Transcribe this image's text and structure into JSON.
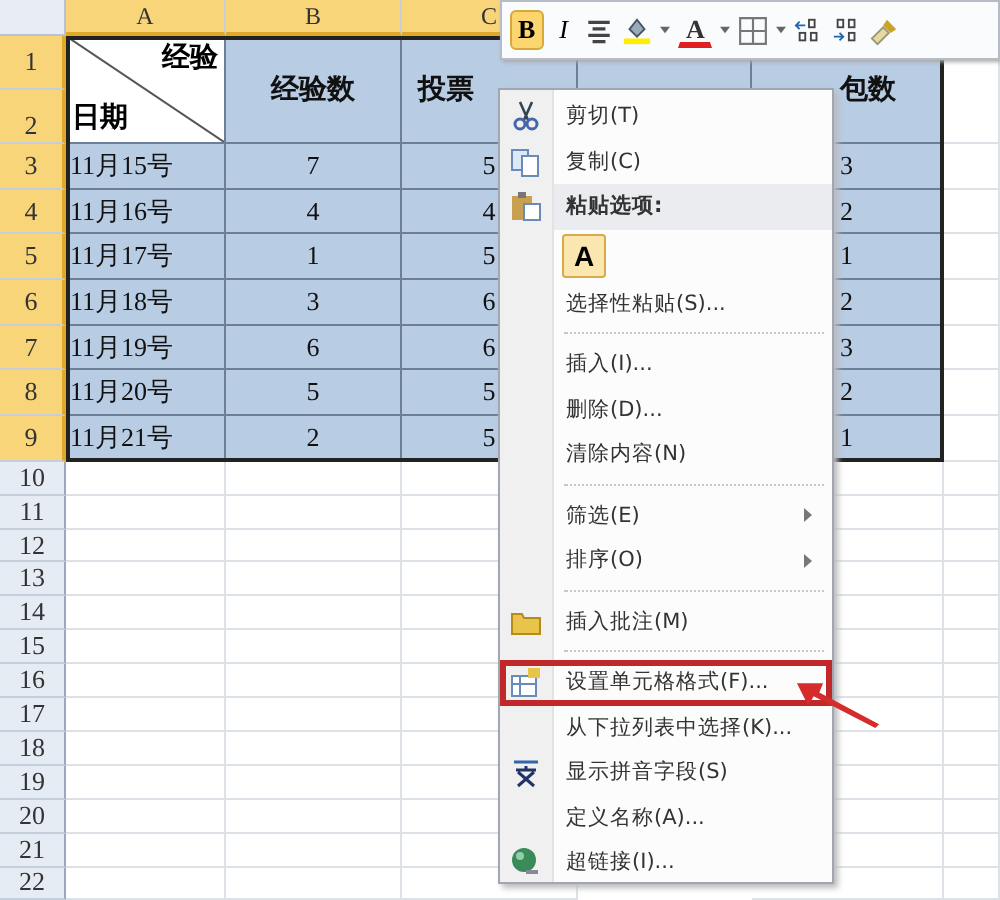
{
  "sheet": {
    "column_letters": [
      "A",
      "B",
      "C"
    ],
    "header": {
      "row_numbers": [
        "1",
        "2"
      ],
      "diagonal_top": "经验",
      "diagonal_bottom": "日期",
      "col_b": "经验数",
      "col_c": "投票",
      "col_e": "包数"
    },
    "rows": [
      {
        "num": "3",
        "date": "11月15号",
        "b": "7",
        "c": "5",
        "e": "3"
      },
      {
        "num": "4",
        "date": "11月16号",
        "b": "4",
        "c": "4",
        "e": "2"
      },
      {
        "num": "5",
        "date": "11月17号",
        "b": "1",
        "c": "5",
        "e": "1"
      },
      {
        "num": "6",
        "date": "11月18号",
        "b": "3",
        "c": "6",
        "e": "2"
      },
      {
        "num": "7",
        "date": "11月19号",
        "b": "6",
        "c": "6",
        "e": "3"
      },
      {
        "num": "8",
        "date": "11月20号",
        "b": "5",
        "c": "5",
        "e": "2"
      },
      {
        "num": "9",
        "date": "11月21号",
        "b": "2",
        "c": "5",
        "e": "1"
      }
    ],
    "empty_row_numbers": [
      "10",
      "11",
      "12",
      "13",
      "14",
      "15",
      "16",
      "17",
      "18",
      "19",
      "20",
      "21",
      "22"
    ]
  },
  "mini_toolbar": {
    "bold": "B",
    "bold_selected": true,
    "italic": "I",
    "font_color": "A"
  },
  "context_menu": [
    {
      "kind": "item",
      "label": "剪切(T)"
    },
    {
      "kind": "item",
      "label": "复制(C)"
    },
    {
      "kind": "header",
      "label": "粘贴选项:"
    },
    {
      "kind": "paste",
      "label": "A"
    },
    {
      "kind": "item",
      "label": "选择性粘贴(S)..."
    },
    {
      "kind": "separator"
    },
    {
      "kind": "item",
      "label": "插入(I)..."
    },
    {
      "kind": "item",
      "label": "删除(D)..."
    },
    {
      "kind": "item",
      "label": "清除内容(N)"
    },
    {
      "kind": "separator"
    },
    {
      "kind": "item",
      "label": "筛选(E)",
      "submenu": true
    },
    {
      "kind": "item",
      "label": "排序(O)",
      "submenu": true
    },
    {
      "kind": "separator"
    },
    {
      "kind": "item",
      "label": "插入批注(M)"
    },
    {
      "kind": "separator"
    },
    {
      "kind": "item",
      "label": "设置单元格格式(F)...",
      "highlighted": true
    },
    {
      "kind": "item",
      "label": "从下拉列表中选择(K)..."
    },
    {
      "kind": "item",
      "label": "显示拼音字段(S)"
    },
    {
      "kind": "item",
      "label": "定义名称(A)..."
    },
    {
      "kind": "item",
      "label": "超链接(I)..."
    }
  ]
}
